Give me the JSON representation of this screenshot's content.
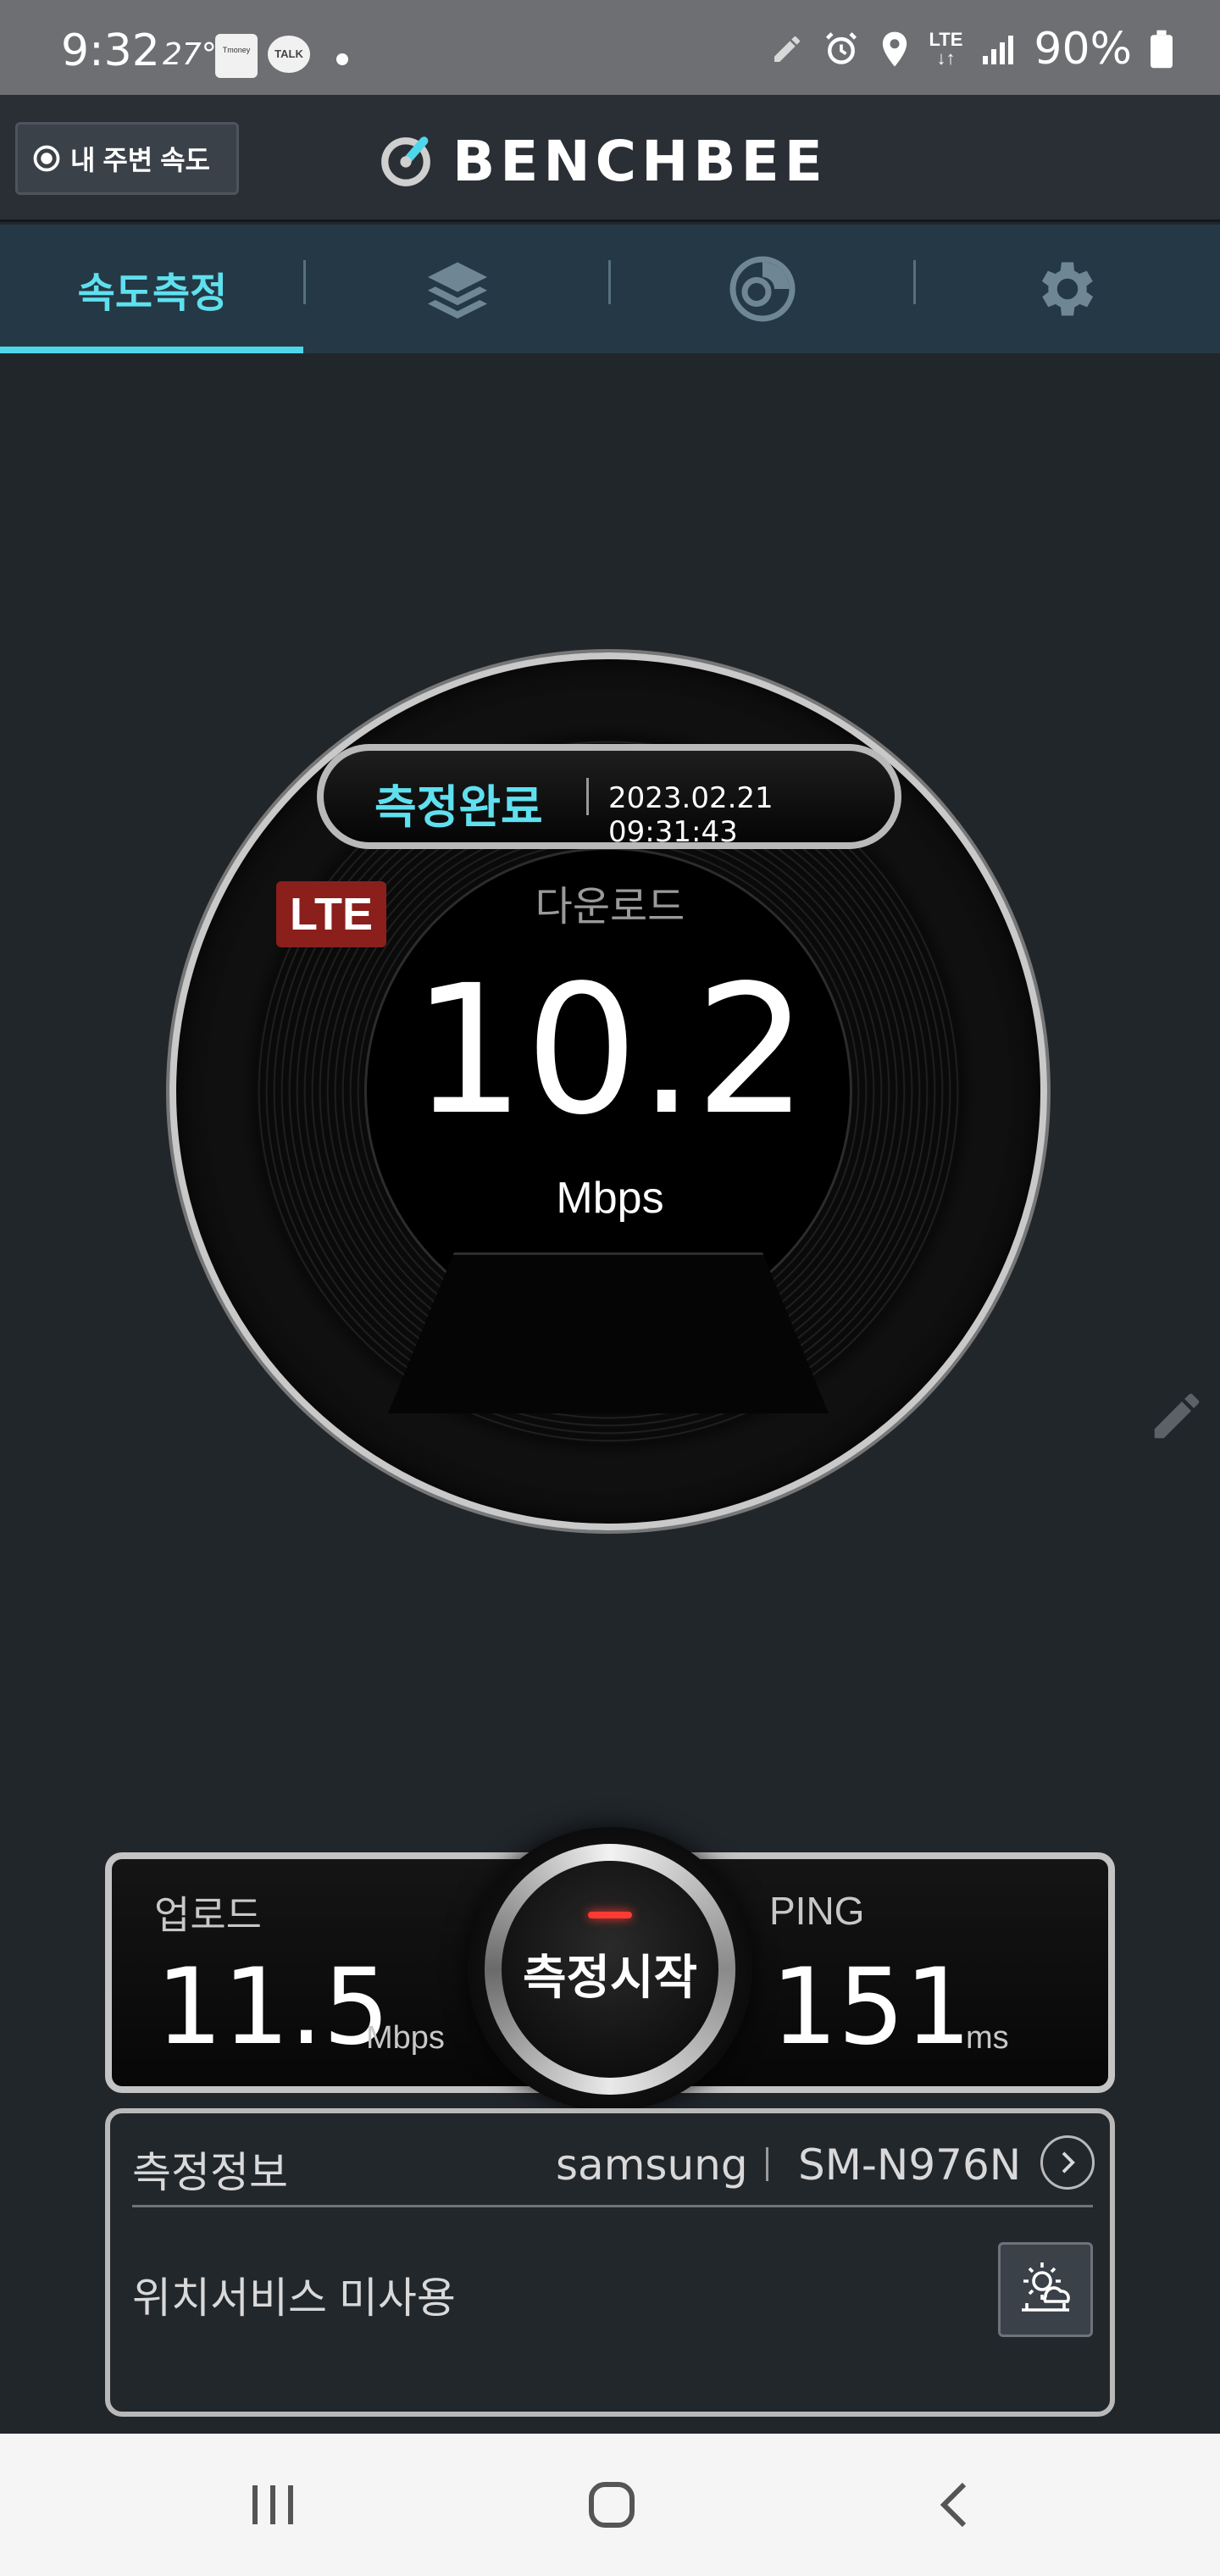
{
  "status_bar": {
    "time": "9:32",
    "temperature": "27°",
    "tmoney_label": "Tmoney",
    "talk_label": "TALK",
    "network_type": "LTE",
    "battery_percent": "90%"
  },
  "header": {
    "nearby_button_label": "내 주변 속도",
    "logo_text": "BENCHBEE"
  },
  "tabs": [
    {
      "label": "속도측정",
      "icon": "speed-tab",
      "active": true
    },
    {
      "label": "",
      "icon": "layers-icon",
      "active": false
    },
    {
      "label": "",
      "icon": "history-disc-icon",
      "active": false
    },
    {
      "label": "",
      "icon": "gear-icon",
      "active": false
    }
  ],
  "gauge": {
    "status_label": "측정완료",
    "timestamp": "2023.02.21 09:31:43",
    "network_badge": "LTE",
    "download_label": "다운로드",
    "download_value": "10.2",
    "download_unit": "Mbps"
  },
  "results": {
    "upload_label": "업로드",
    "upload_value": "11.5",
    "upload_unit": "Mbps",
    "ping_label": "PING",
    "ping_value": "151",
    "ping_unit": "ms",
    "start_button_label": "측정시작"
  },
  "info": {
    "title": "측정정보",
    "brand": "samsung",
    "model": "SM-N976N",
    "location_status": "위치서비스 미사용"
  },
  "colors": {
    "accent": "#5fe0ef",
    "background": "#21262b",
    "tab_bar": "#243945",
    "lte_badge": "#8a1f1c",
    "start_led": "#ff3a32"
  }
}
